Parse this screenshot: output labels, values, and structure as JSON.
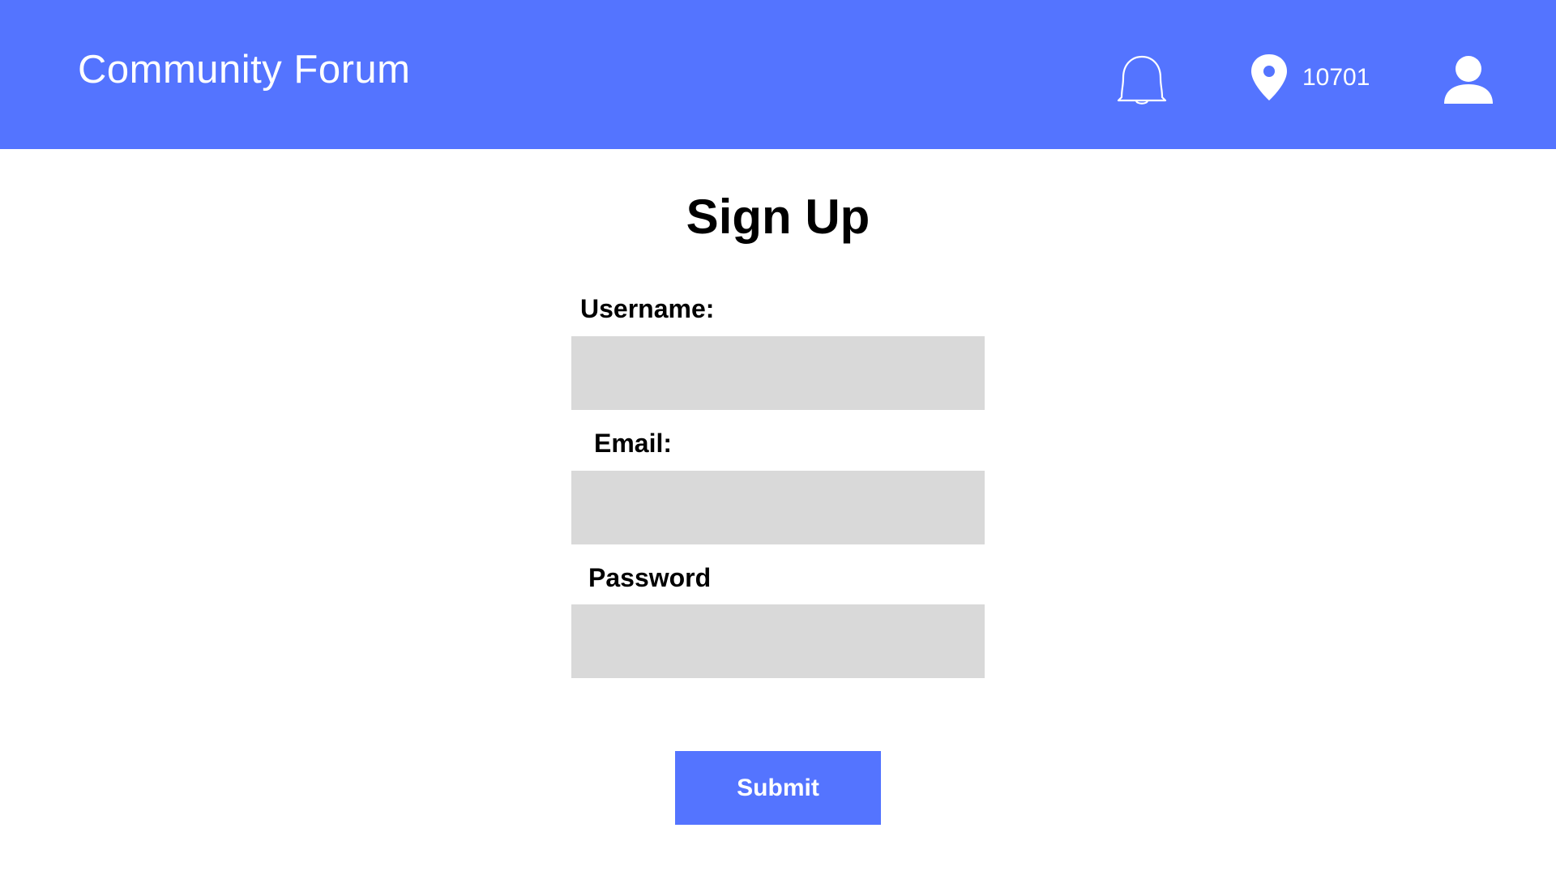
{
  "header": {
    "title": "Community Forum",
    "bell_icon": "bell-outline-icon",
    "location_icon": "map-pin-icon",
    "zip_code": "10701",
    "user_icon": "user-profile-icon",
    "background_color": "#5474ff"
  },
  "form": {
    "title": "Sign Up",
    "username_label": "Username:",
    "username_value": "",
    "email_label": "Email:",
    "email_value": "",
    "password_label": "Password",
    "password_value": "",
    "submit_label": "Submit",
    "input_color": "#d9d9d9",
    "button_color": "#5474ff"
  }
}
